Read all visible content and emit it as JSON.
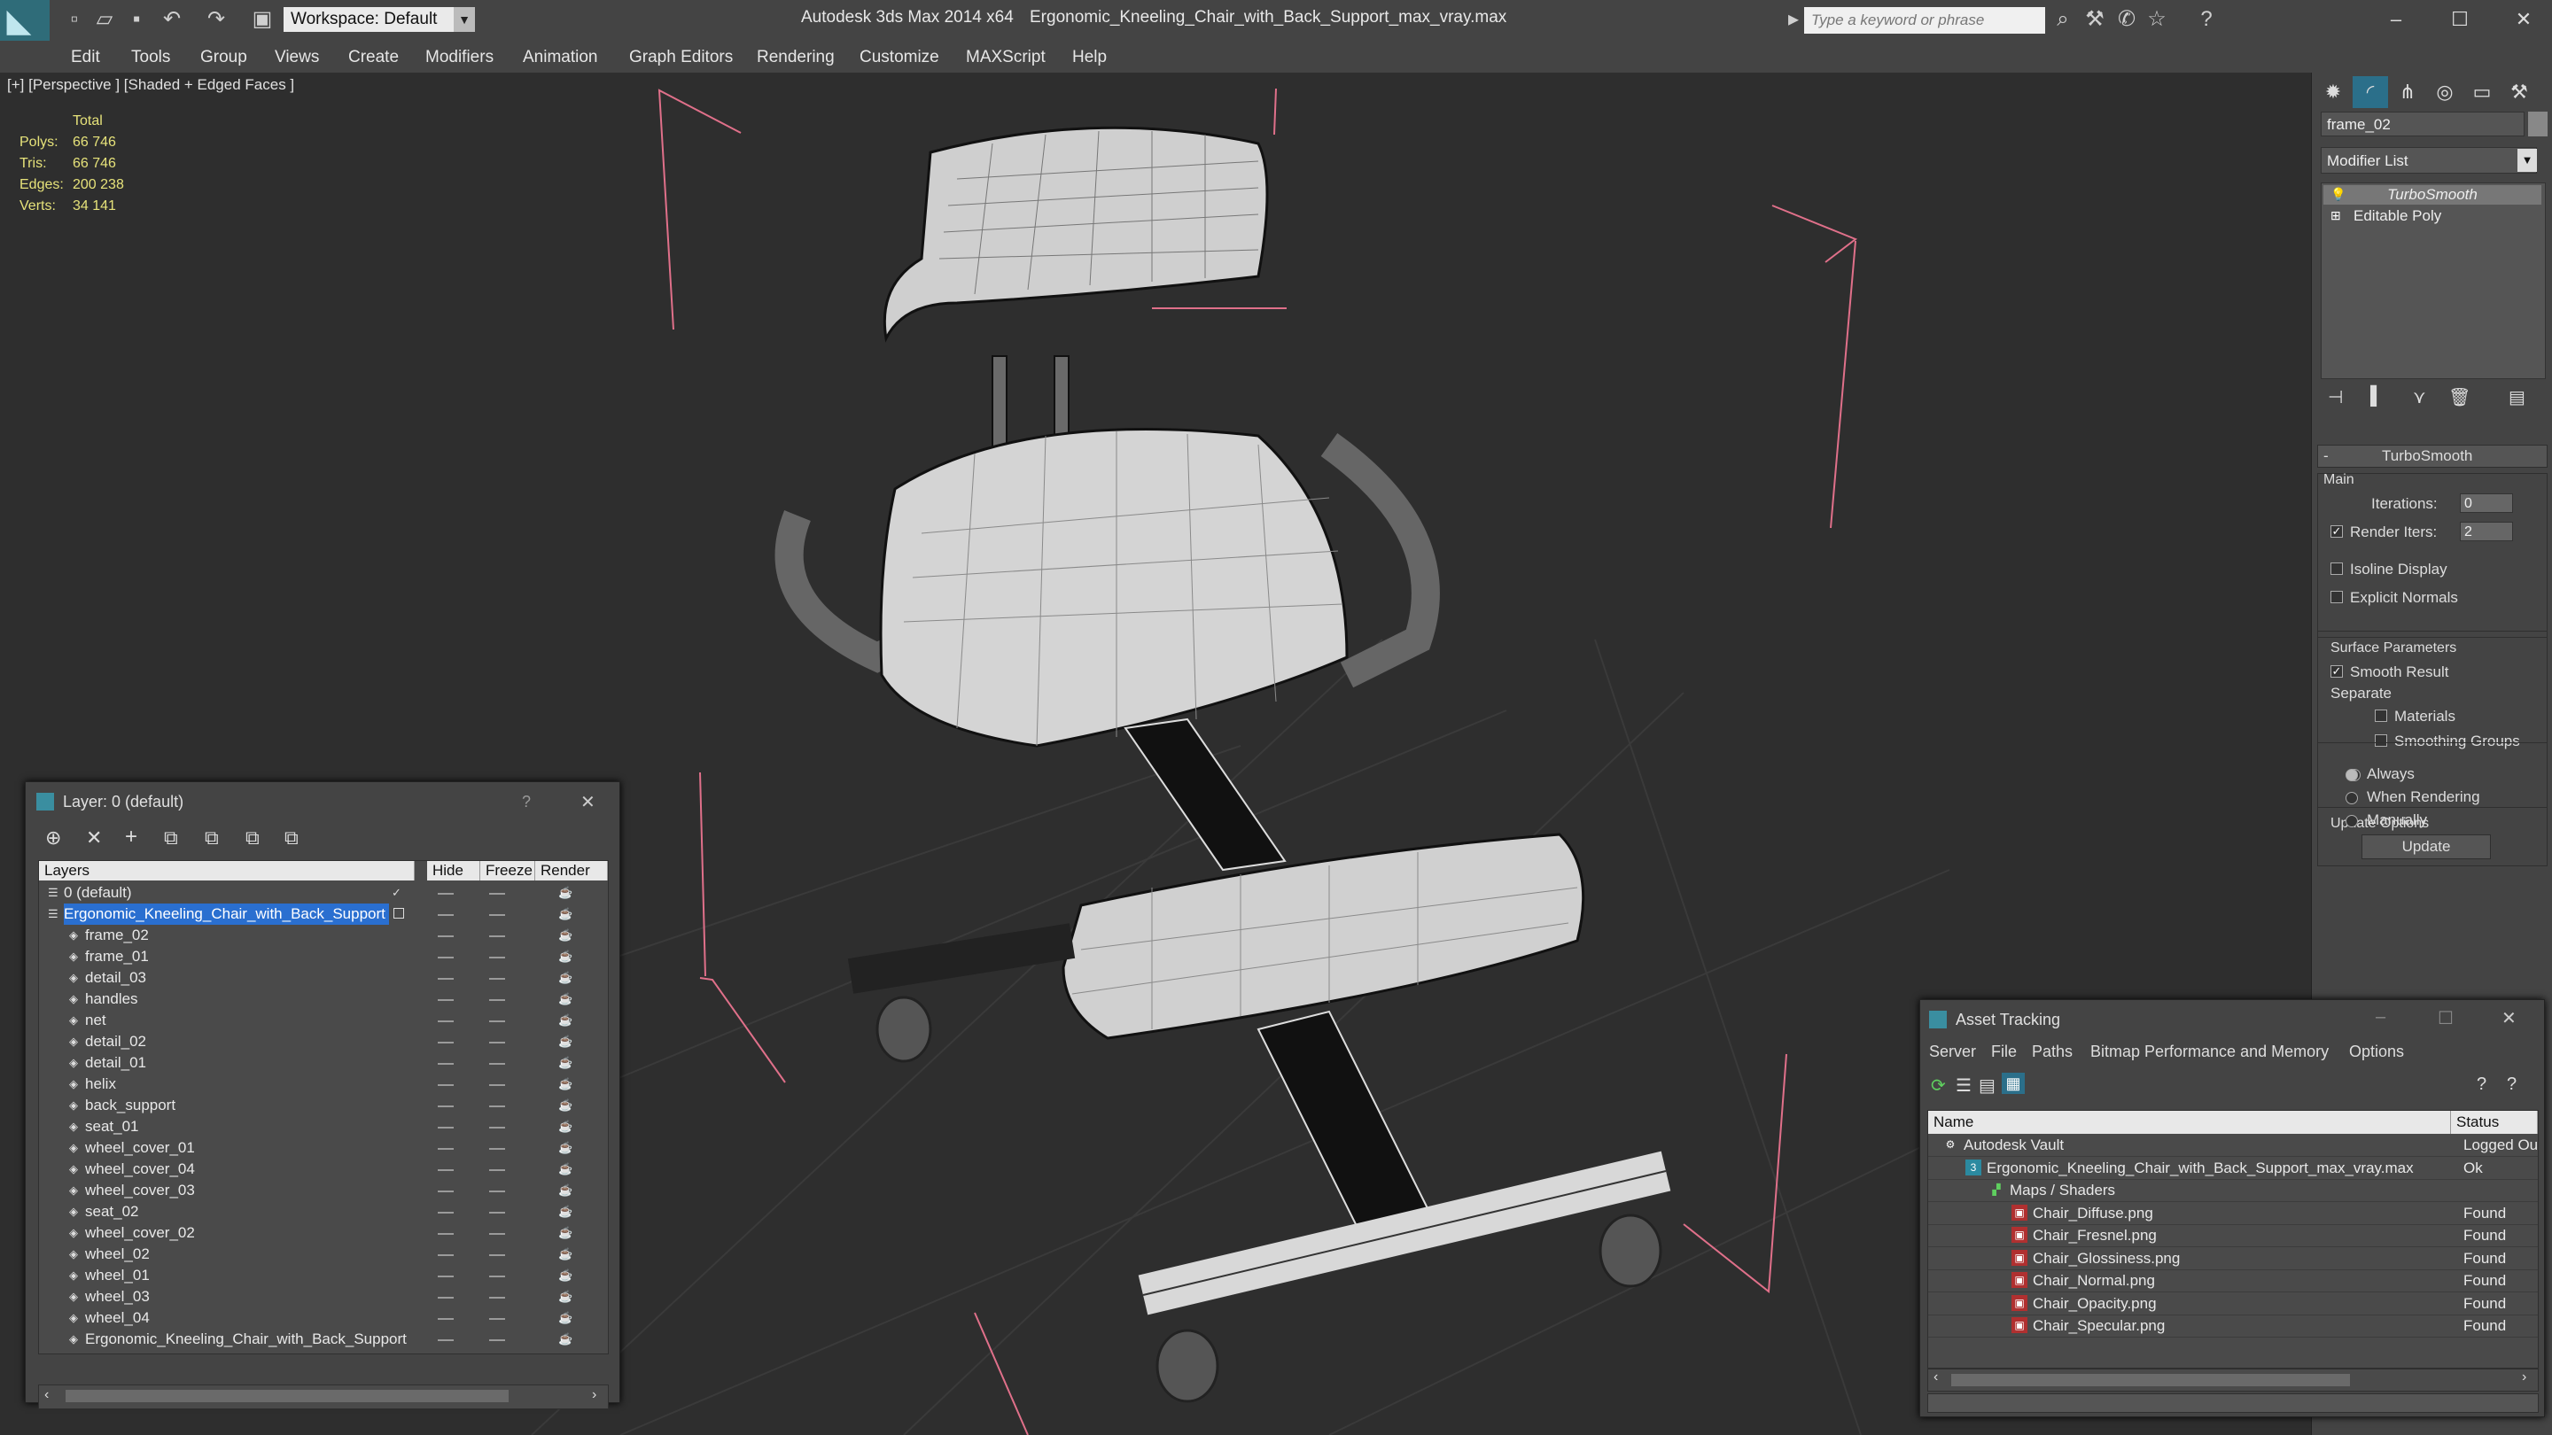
{
  "app": {
    "title": "Autodesk 3ds Max  2014 x64",
    "file": "Ergonomic_Kneeling_Chair_with_Back_Support_max_vray.max",
    "workspace": "Workspace: Default",
    "search_placeholder": "Type a keyword or phrase"
  },
  "menu": [
    "Edit",
    "Tools",
    "Group",
    "Views",
    "Create",
    "Modifiers",
    "Animation",
    "Graph Editors",
    "Rendering",
    "Customize",
    "MAXScript",
    "Help"
  ],
  "viewport": {
    "label": "[+] [Perspective ] [Shaded + Edged Faces ]",
    "stats": {
      "header": "Total",
      "rows": [
        {
          "label": "Polys:",
          "value": "66 746"
        },
        {
          "label": "Tris:",
          "value": "66 746"
        },
        {
          "label": "Edges:",
          "value": "200 238"
        },
        {
          "label": "Verts:",
          "value": "34 141"
        }
      ]
    }
  },
  "command_panel": {
    "object_name": "frame_02",
    "modifier_list": "Modifier List",
    "stack": [
      "TurboSmooth",
      "Editable Poly"
    ],
    "rollout_title": "TurboSmooth",
    "main_group": "Main",
    "iterations_label": "Iterations:",
    "iterations_value": "0",
    "render_iters_label": "Render Iters:",
    "render_iters_value": "2",
    "isoline": "Isoline Display",
    "explicit": "Explicit Normals",
    "surface_group": "Surface Parameters",
    "smooth_result": "Smooth Result",
    "separate": "Separate",
    "materials": "Materials",
    "smoothing_groups": "Smoothing Groups",
    "update_group": "Update Options",
    "always": "Always",
    "when_rendering": "When Rendering",
    "manually": "Manually",
    "update_btn": "Update"
  },
  "layer_dialog": {
    "title": "Layer: 0 (default)",
    "question": "?",
    "columns": [
      "Layers",
      "Hide",
      "Freeze",
      "Render"
    ],
    "rows": [
      {
        "name": "0 (default)",
        "level": 0
      },
      {
        "name": "Ergonomic_Kneeling_Chair_with_Back_Support",
        "level": 0,
        "selected": true
      },
      {
        "name": "frame_02",
        "level": 1
      },
      {
        "name": "frame_01",
        "level": 1
      },
      {
        "name": "detail_03",
        "level": 1
      },
      {
        "name": "handles",
        "level": 1
      },
      {
        "name": "net",
        "level": 1
      },
      {
        "name": "detail_02",
        "level": 1
      },
      {
        "name": "detail_01",
        "level": 1
      },
      {
        "name": "helix",
        "level": 1
      },
      {
        "name": "back_support",
        "level": 1
      },
      {
        "name": "seat_01",
        "level": 1
      },
      {
        "name": "wheel_cover_01",
        "level": 1
      },
      {
        "name": "wheel_cover_04",
        "level": 1
      },
      {
        "name": "wheel_cover_03",
        "level": 1
      },
      {
        "name": "seat_02",
        "level": 1
      },
      {
        "name": "wheel_cover_02",
        "level": 1
      },
      {
        "name": "wheel_02",
        "level": 1
      },
      {
        "name": "wheel_01",
        "level": 1
      },
      {
        "name": "wheel_03",
        "level": 1
      },
      {
        "name": "wheel_04",
        "level": 1
      },
      {
        "name": "Ergonomic_Kneeling_Chair_with_Back_Support",
        "level": 1
      }
    ]
  },
  "asset_dialog": {
    "title": "Asset Tracking",
    "menu": [
      "Server",
      "File",
      "Paths",
      "Bitmap Performance and Memory",
      "Options"
    ],
    "columns": [
      "Name",
      "Status"
    ],
    "rows": [
      {
        "name": "Autodesk Vault",
        "status": "Logged Ou",
        "level": 0,
        "icon": "vault-icon"
      },
      {
        "name": "Ergonomic_Kneeling_Chair_with_Back_Support_max_vray.max",
        "status": "Ok",
        "level": 1,
        "icon": "max-file-icon"
      },
      {
        "name": "Maps / Shaders",
        "status": "",
        "level": 2,
        "icon": "maps-folder-icon"
      },
      {
        "name": "Chair_Diffuse.png",
        "status": "Found",
        "level": 3,
        "icon": "png-file-icon"
      },
      {
        "name": "Chair_Fresnel.png",
        "status": "Found",
        "level": 3,
        "icon": "png-file-icon"
      },
      {
        "name": "Chair_Glossiness.png",
        "status": "Found",
        "level": 3,
        "icon": "png-file-icon"
      },
      {
        "name": "Chair_Normal.png",
        "status": "Found",
        "level": 3,
        "icon": "png-file-icon"
      },
      {
        "name": "Chair_Opacity.png",
        "status": "Found",
        "level": 3,
        "icon": "png-file-icon"
      },
      {
        "name": "Chair_Specular.png",
        "status": "Found",
        "level": 3,
        "icon": "png-file-icon"
      }
    ]
  }
}
